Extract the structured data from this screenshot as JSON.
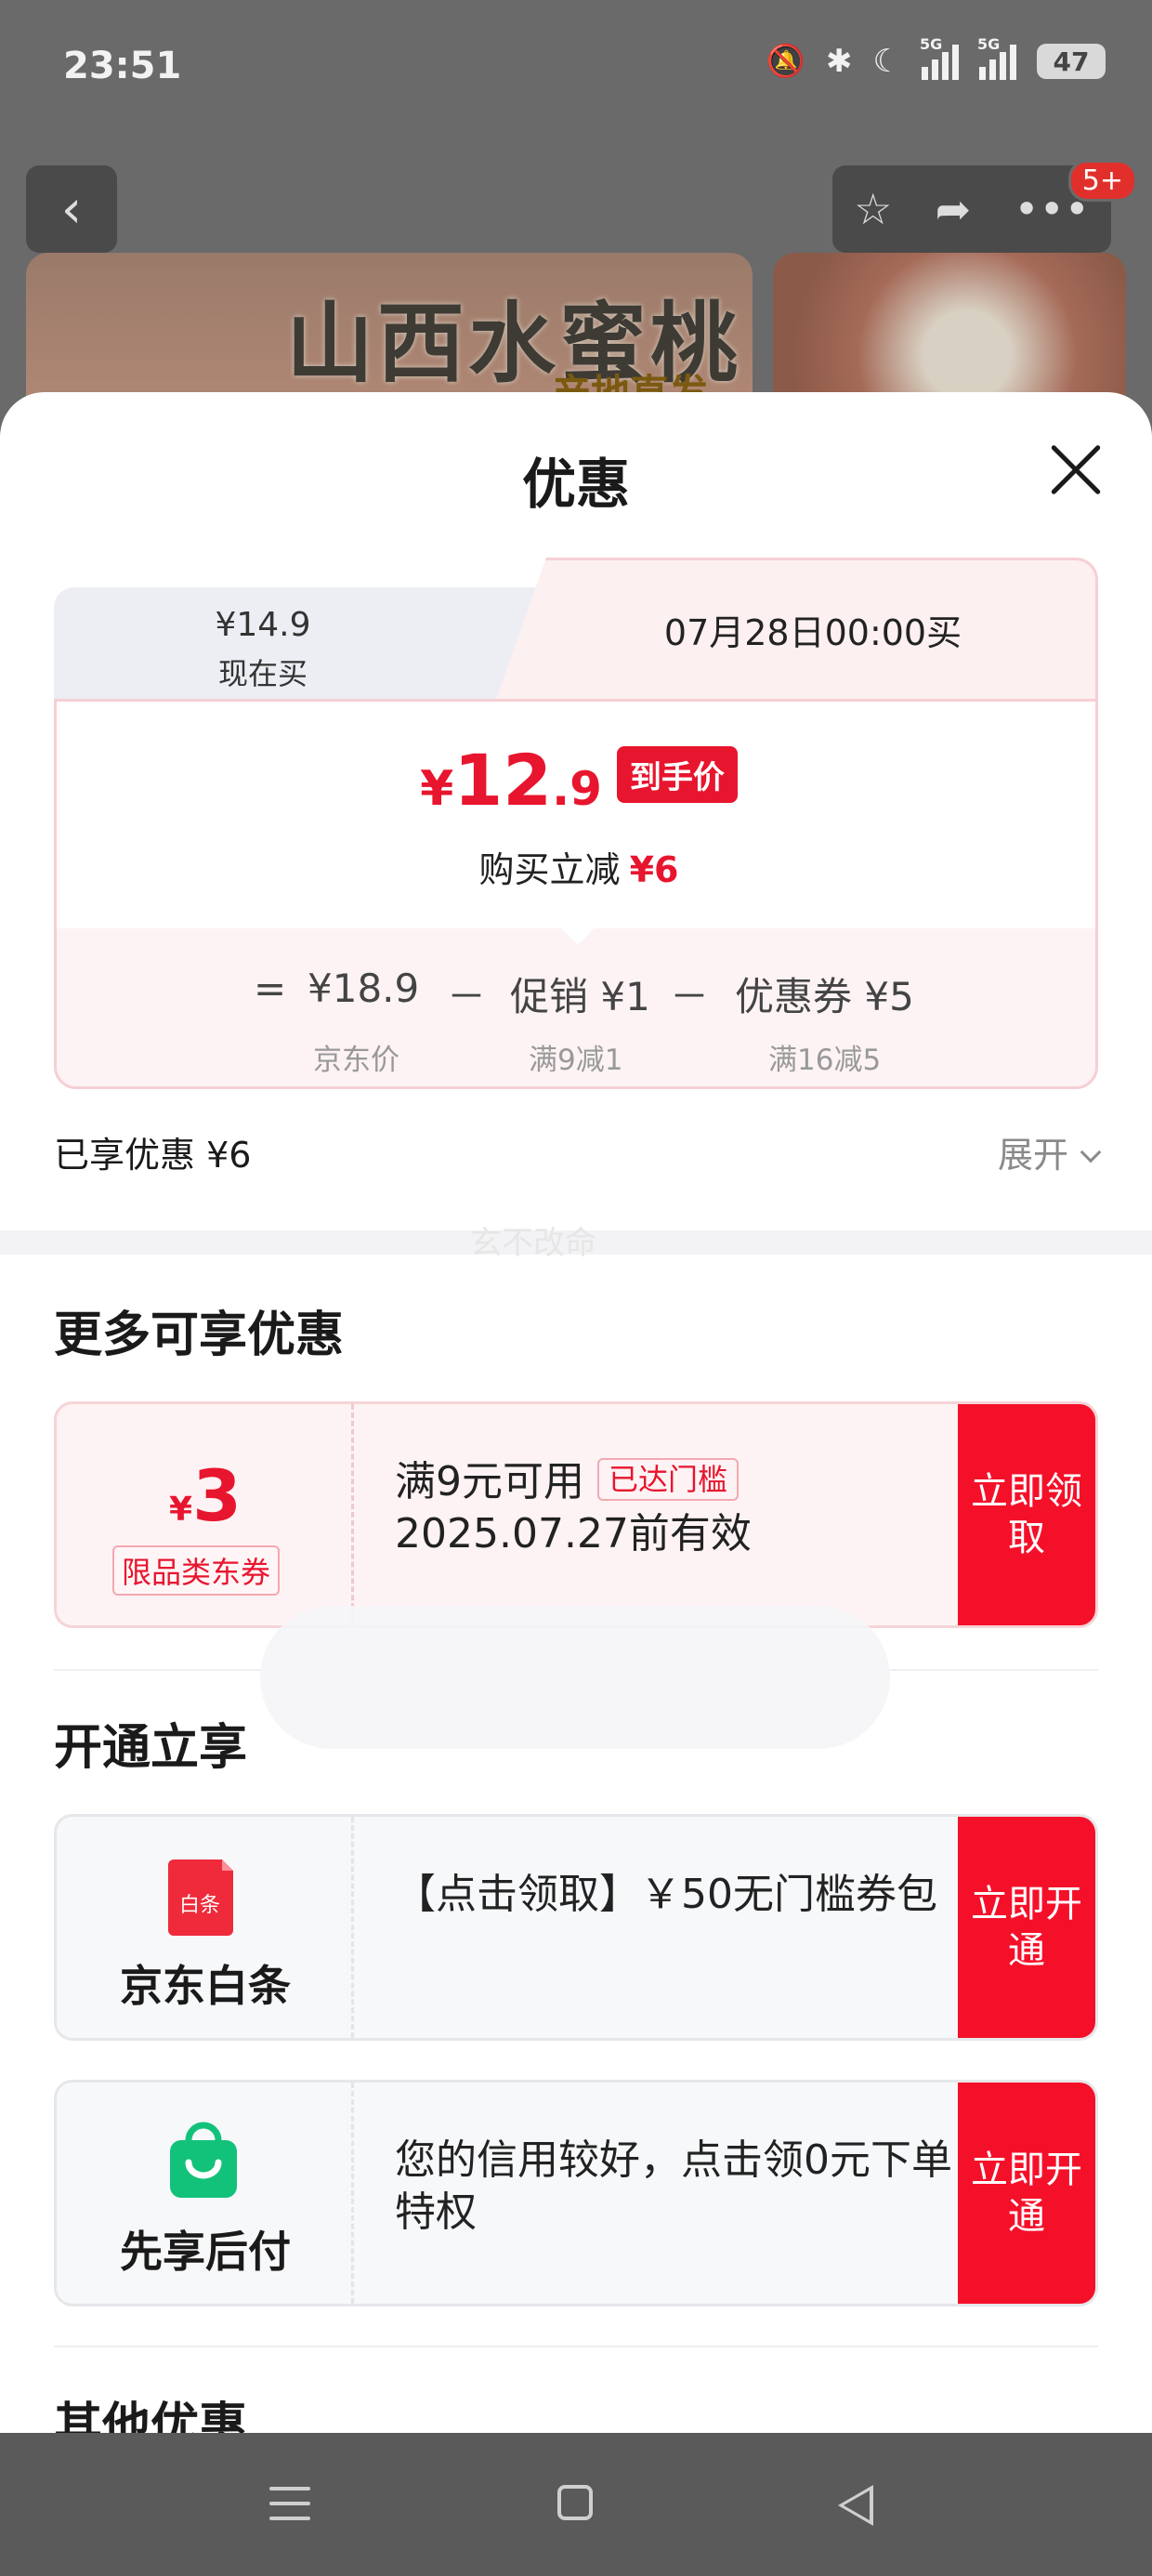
{
  "status_bar": {
    "time": "23:51",
    "battery": "47",
    "network_1": "5G",
    "network_2": "5G"
  },
  "product_page": {
    "banner_title": "山西水蜜桃",
    "banner_subtitle": "产地直发",
    "cart_badge": "5+"
  },
  "sheet": {
    "title": "优惠",
    "price_tabs": {
      "now": {
        "price": "¥14.9",
        "label": "现在买"
      },
      "later": {
        "label": "07月28日00:00买"
      }
    },
    "final_price": {
      "yen": "¥",
      "integer": "12",
      "decimal": ".9",
      "tag": "到手价"
    },
    "saving": {
      "label": "购买立减",
      "amount": "¥6"
    },
    "breakdown": {
      "eq": "=",
      "jd_price": "¥18.9",
      "jd_price_label": "京东价",
      "minus1": "－",
      "promo": "促销 ¥1",
      "promo_label": "满9减1",
      "minus2": "－",
      "coupon": "优惠券 ¥5",
      "coupon_label": "满16减5"
    },
    "enjoyed": "已享优惠 ¥6",
    "expand": "展开",
    "watermark": "玄不改命",
    "more_title": "更多可享优惠",
    "coupon_3": {
      "yen": "¥",
      "amount": "3",
      "category": "限品类东券",
      "condition": "满9元可用",
      "status_tag": "已达门槛",
      "validity": "2025.07.27前有效",
      "button": "立即领取"
    },
    "open_title": "开通立享",
    "baitiao": {
      "logo_text": "白条",
      "name": "京东白条",
      "desc": "【点击领取】￥50无门槛券包",
      "button": "立即开通"
    },
    "xianxiang": {
      "name": "先享后付",
      "desc": "您的信用较好，点击领0元下单特权",
      "button": "立即开通"
    },
    "other_title": "其他优惠"
  },
  "colors": {
    "accent_red": "#e8152e",
    "button_red": "#f5102a",
    "card_pink": "#fdf3f4"
  }
}
